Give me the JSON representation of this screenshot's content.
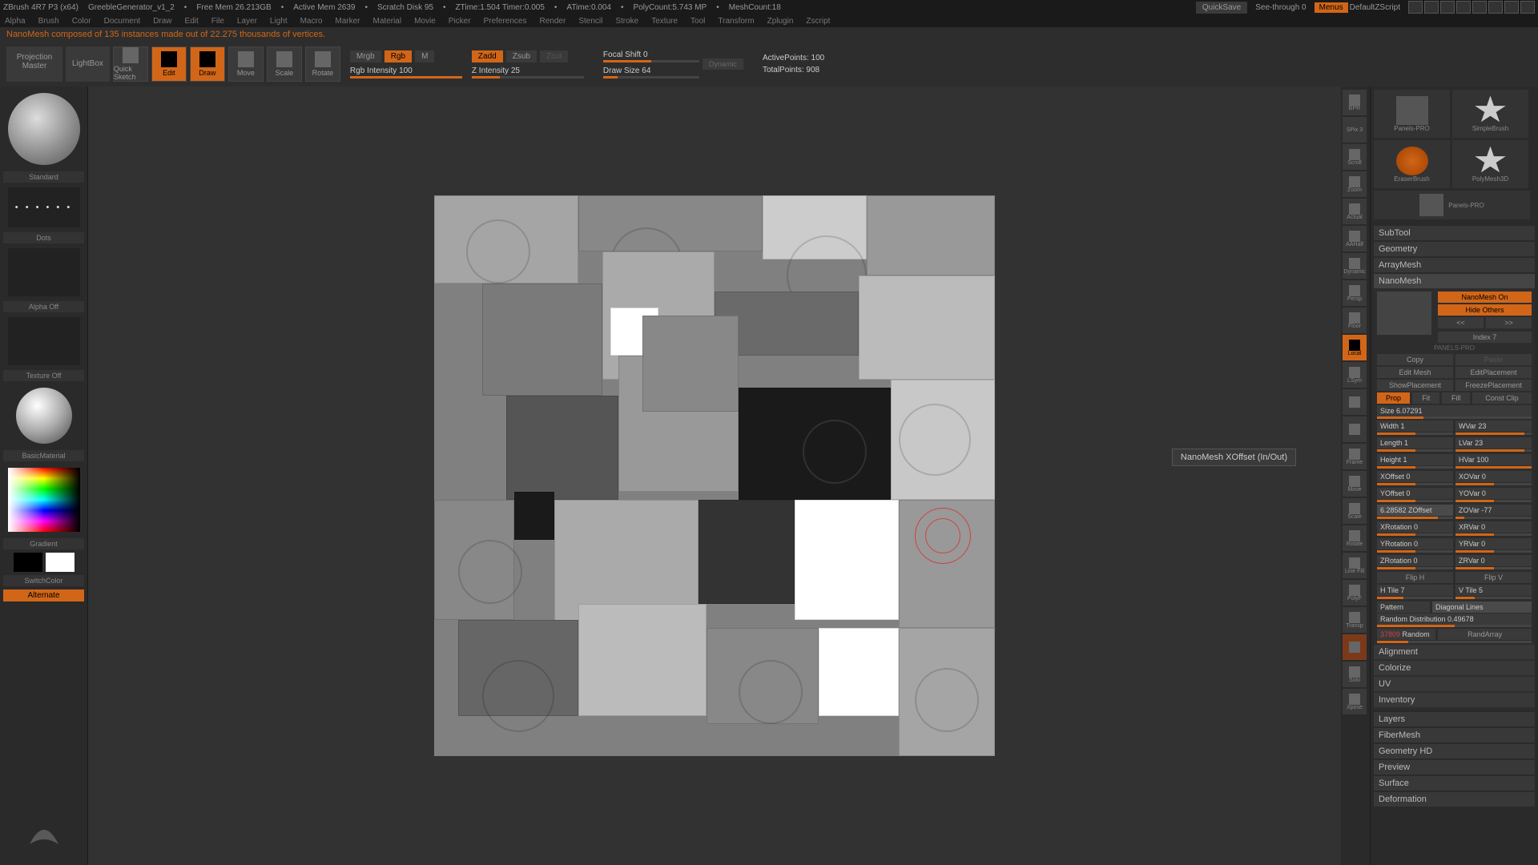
{
  "titlebar": {
    "app": "ZBrush 4R7 P3 (x64)",
    "doc": "GreebleGenerator_v1_2",
    "mem": "Free Mem 26.213GB",
    "active": "Active Mem 2639",
    "scratch": "Scratch Disk 95",
    "ztime": "ZTime:1.504 Timer:0.005",
    "atime": "ATime:0.004",
    "poly": "PolyCount:5.743 MP",
    "mesh": "MeshCount:18",
    "quicksave": "QuickSave",
    "seethrough": "See-through  0",
    "menus": "Menus",
    "script": "DefaultZScript"
  },
  "menubar": [
    "Alpha",
    "Brush",
    "Color",
    "Document",
    "Draw",
    "Edit",
    "File",
    "Layer",
    "Light",
    "Macro",
    "Marker",
    "Material",
    "Movie",
    "Picker",
    "Preferences",
    "Render",
    "Stencil",
    "Stroke",
    "Texture",
    "Tool",
    "Transform",
    "Zplugin",
    "Zscript"
  ],
  "status": "NanoMesh composed of 135 instances made out of 22.275 thousands of vertices.",
  "toolbar": {
    "projection": "Projection Master",
    "lightbox": "LightBox",
    "quicksketch": "Quick Sketch",
    "edit": "Edit",
    "draw": "Draw",
    "move": "Move",
    "scale": "Scale",
    "rotate": "Rotate",
    "mrgb": "Mrgb",
    "rgb": "Rgb",
    "m": "M",
    "rgbint": "Rgb Intensity 100",
    "zadd": "Zadd",
    "zsub": "Zsub",
    "zcut": "Zcut",
    "zint": "Z Intensity 25",
    "focal": "Focal Shift 0",
    "drawsize": "Draw Size 64",
    "dynamic": "Dynamic",
    "activepts": "ActivePoints: 100",
    "totalpts": "TotalPoints: 908"
  },
  "left": {
    "standard": "Standard",
    "dots": "Dots",
    "alpha": "Alpha Off",
    "texture": "Texture Off",
    "material": "BasicMaterial",
    "gradient": "Gradient",
    "switchcolor": "SwitchColor",
    "alternate": "Alternate"
  },
  "rtools": [
    "BPR",
    "SPix 3",
    "Scroll",
    "Zoom",
    "Actual",
    "AAHalf",
    "Dynamic",
    "Persp",
    "Floor",
    "Local",
    "LSym",
    "",
    "",
    "Frame",
    "Move",
    "Scale",
    "Rotate",
    "Line Fill",
    "PolyF",
    "Transp",
    "",
    "Solo",
    "Xpose"
  ],
  "tools": [
    {
      "name": "Panels-PRO"
    },
    {
      "name": "SimpleBrush"
    },
    {
      "name": "EraserBrush"
    },
    {
      "name": "PolyMesh3D"
    },
    {
      "name": "Panels-PRO"
    }
  ],
  "palettes": {
    "subtool": "SubTool",
    "geometry": "Geometry",
    "arraymesh": "ArrayMesh",
    "nanomesh": "NanoMesh",
    "layers": "Layers",
    "fibermesh": "FiberMesh",
    "geometryhd": "Geometry HD",
    "preview": "Preview",
    "surface": "Surface",
    "deformation": "Deformation"
  },
  "nano": {
    "on": "NanoMesh On",
    "hide": "Hide Others",
    "prev": "<<",
    "next": ">>",
    "index": "Index 7",
    "copy": "Copy",
    "paste": "Paste",
    "editmesh": "Edit Mesh",
    "editplace": "EditPlacement",
    "showplace": "ShowPlacement",
    "freezeplace": "FreezePlacement",
    "prop": "Prop",
    "fit": "Fit",
    "fill": "Fill",
    "constclip": "Const Clip",
    "size": "Size 6.07291",
    "width": "Width 1",
    "wvar": "WVar 23",
    "length": "Length 1",
    "lvar": "LVar 23",
    "height": "Height 1",
    "hvar": "HVar 100",
    "xoffset": "XOffset 0",
    "xovar": "XOVar 0",
    "yoffset": "YOffset 0",
    "yovar": "YOVar 0",
    "zoffset": "6.28582 ZOffset",
    "zovar": "ZOVar -77",
    "xrot": "XRotation 0",
    "xrvar": "XRVar 0",
    "yrot": "YRotation 0",
    "yrvar": "YRVar 0",
    "zrot": "ZRotation 0",
    "zrvar": "ZRVar 0",
    "fliph": "Flip H",
    "flipv": "Flip V",
    "htile": "H Tile 7",
    "vtile": "V Tile 5",
    "pattern": "Pattern",
    "patternval": "Diagonal Lines",
    "random": "Random Distribution 0.49678",
    "seed": "37809",
    "seedlbl": "Random",
    "randarray": "RandArray",
    "alignment": "Alignment",
    "colorize": "Colorize",
    "uv": "UV",
    "inventory": "Inventory"
  },
  "tooltip": "NanoMesh XOffset (In/Out)",
  "thumb_label": "PANELS-PRO"
}
